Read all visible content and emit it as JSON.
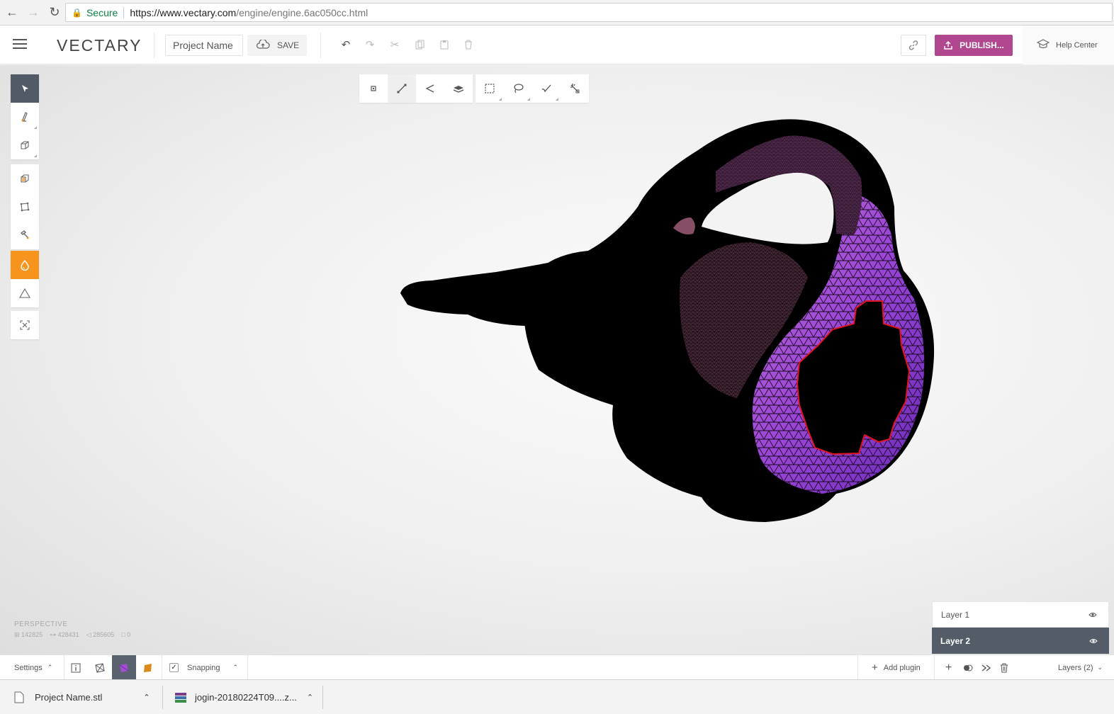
{
  "browser": {
    "secure_label": "Secure",
    "url_host": "https://www.vectary.com",
    "url_path": "/engine/engine.6ac050cc.html"
  },
  "header": {
    "logo": "VECTARY",
    "project_name": "Project Name",
    "save_label": "SAVE",
    "publish_label": "PUBLISH...",
    "help_label": "Help Center"
  },
  "viewport": {
    "camera_label": "PERSPECTIVE",
    "stats": [
      "142825",
      "428431",
      "285605",
      "0"
    ]
  },
  "layers": {
    "items": [
      {
        "label": "Layer 1",
        "selected": false
      },
      {
        "label": "Layer 2",
        "selected": true
      }
    ],
    "count_label": "Layers (2)"
  },
  "bottom_bar": {
    "settings_label": "Settings",
    "snapping_label": "Snapping",
    "snapping_checked": true,
    "add_plugin_label": "Add plugin"
  },
  "downloads": [
    {
      "name": "Project Name.stl"
    },
    {
      "name": "jogin-20180224T09....z..."
    }
  ],
  "colors": {
    "publish": "#b0478f",
    "tool_selected": "#525a65",
    "tool_active_orange": "#f7941d",
    "layer_selected": "#545c67",
    "mesh_purple": "#8e3ec9",
    "selection_outline": "#e0141e"
  }
}
